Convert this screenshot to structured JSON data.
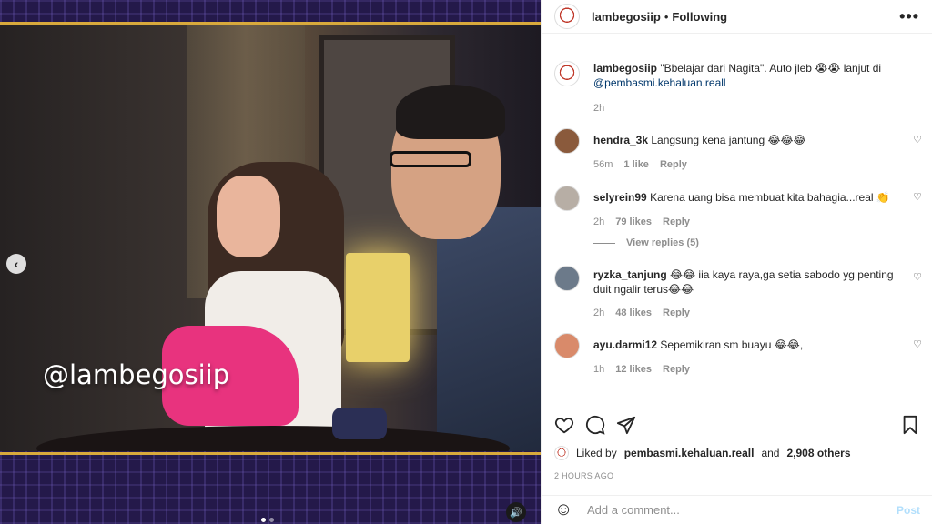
{
  "media": {
    "watermark": "@lambegosiip",
    "prev_label": "‹",
    "mute_label": "🔊"
  },
  "header": {
    "username": "lambegosiip",
    "separator": "•",
    "follow_status": "Following",
    "more_label": "•••"
  },
  "caption": {
    "username": "lambegosiip",
    "text": "\"Bbelajar dari Nagita\". Auto jleb 😭😭 lanjut di",
    "mention": "@pembasmi.kehaluan.reall",
    "time": "2h"
  },
  "comments": [
    {
      "username": "hendra_3k",
      "text": "Langsung kena jantung 😂😂😂",
      "time": "56m",
      "likes": "1 like",
      "reply": "Reply"
    },
    {
      "username": "selyrein99",
      "text": "Karena uang bisa membuat kita bahagia...real 👏",
      "time": "2h",
      "likes": "79 likes",
      "reply": "Reply",
      "view_replies": "View replies (5)"
    },
    {
      "username": "ryzka_tanjung",
      "text": "😂😂 iia kaya raya,ga setia sabodo yg penting duit ngalir terus😂😂",
      "time": "2h",
      "likes": "48 likes",
      "reply": "Reply"
    },
    {
      "username": "ayu.darmi12",
      "text": "Sepemikiran sm buayu 😂😂,",
      "time": "1h",
      "likes": "12 likes",
      "reply": "Reply"
    }
  ],
  "likes": {
    "prefix": "Liked by",
    "user": "pembasmi.kehaluan.reall",
    "and": "and",
    "others": "2,908 others"
  },
  "post_time": "2 HOURS AGO",
  "add_comment": {
    "placeholder": "Add a comment...",
    "post_label": "Post",
    "emoji": "☺"
  },
  "colors": {
    "link": "#00376b",
    "meta": "#8e8e8e",
    "post_disabled": "#b2dffc",
    "gold": "#d8a93c"
  }
}
